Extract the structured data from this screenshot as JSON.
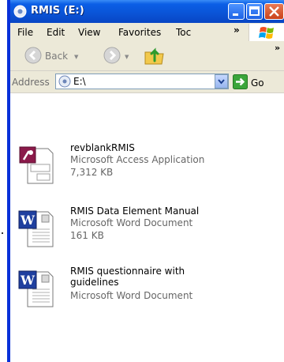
{
  "window": {
    "title": "RMIS (E:)",
    "accent": "#0a55d8"
  },
  "menu": {
    "items": [
      "File",
      "Edit",
      "View",
      "Favorites",
      "Toc"
    ],
    "chevron": "»"
  },
  "toolbar": {
    "back_label": "Back",
    "chevron": "»"
  },
  "address": {
    "label": "Address",
    "value": "E:\\",
    "go_label": "Go"
  },
  "files": [
    {
      "name": "revblankRMIS",
      "type": "Microsoft Access Application",
      "size": "7,312 KB",
      "icon": "access-document-icon"
    },
    {
      "name": "RMIS Data Element Manual",
      "type": "Microsoft Word Document",
      "size": "161 KB",
      "icon": "word-document-icon"
    },
    {
      "name": "RMIS questionnaire with guidelines",
      "type": "Microsoft Word Document",
      "size": "",
      "icon": "word-document-icon"
    }
  ]
}
